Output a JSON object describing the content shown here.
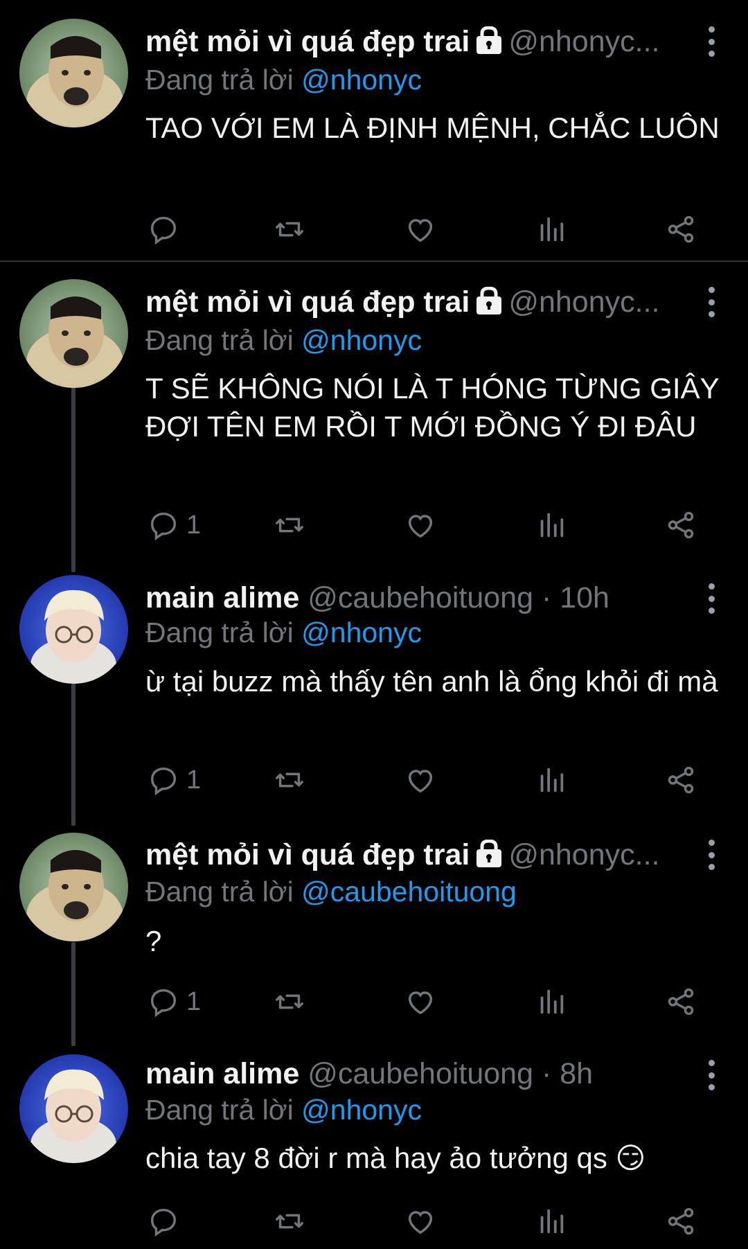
{
  "tweets": [
    {
      "name": "mệt mỏi vì quá đẹp trai",
      "locked": true,
      "handle": "@nhonyc...",
      "replying_prefix": "Đang trả lời",
      "replying_to": "@nhonyc",
      "text": "TAO VỚI EM LÀ ĐỊNH MỆNH, CHẮC LUÔN",
      "reply_count": ""
    },
    {
      "name": "mệt mỏi vì quá đẹp trai",
      "locked": true,
      "handle": "@nhonyc...",
      "replying_prefix": "Đang trả lời",
      "replying_to": "@nhonyc",
      "text": "T SẼ KHÔNG NÓI LÀ T HÓNG TỪNG GIÂY ĐỢI TÊN EM RỒI T MỚI ĐỒNG Ý ĐI ĐÂU",
      "reply_count": "1"
    },
    {
      "name": "main alime",
      "locked": false,
      "handle": "@caubehoituong · 10h",
      "replying_prefix": "Đang trả lời",
      "replying_to": "@nhonyc",
      "text": "ừ tại buzz mà thấy tên anh là ổng khỏi đi mà",
      "reply_count": "1"
    },
    {
      "name": "mệt mỏi vì quá đẹp trai",
      "locked": true,
      "handle": "@nhonyc...",
      "replying_prefix": "Đang trả lời",
      "replying_to": "@caubehoituong",
      "text": "?",
      "reply_count": "1"
    },
    {
      "name": "main alime",
      "locked": false,
      "handle": "@caubehoituong · 8h",
      "replying_prefix": "Đang trả lời",
      "replying_to": "@nhonyc",
      "text": "chia tay 8 đời r mà hay ảo tưởng qs 😏",
      "reply_count": ""
    }
  ],
  "icons": {
    "reply": "reply-icon",
    "retweet": "retweet-icon",
    "like": "heart-icon",
    "views": "views-icon",
    "share": "share-icon",
    "lock": "lock-icon",
    "more": "more-icon"
  },
  "colors": {
    "background": "#000000",
    "name": "#f2f2f2",
    "secondary": "#71767b",
    "mention": "#1d9bf0",
    "thread_line": "#3a3d41"
  }
}
